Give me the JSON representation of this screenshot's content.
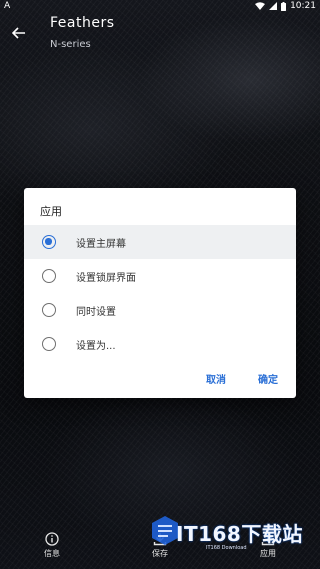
{
  "status_bar": {
    "left_icon": "android-a-icon",
    "left_text": "A",
    "time": "10:21",
    "icons": [
      "wifi-icon",
      "signal-icon",
      "battery-icon"
    ]
  },
  "app_bar": {
    "back_icon": "back-arrow-icon",
    "title": "Feathers",
    "subtitle": "N-series"
  },
  "dialog": {
    "title": "应用",
    "options": [
      {
        "label": "设置主屏幕",
        "selected": true
      },
      {
        "label": "设置锁屏界面",
        "selected": false
      },
      {
        "label": "同时设置",
        "selected": false
      },
      {
        "label": "设置为...",
        "selected": false
      }
    ],
    "cancel_label": "取消",
    "ok_label": "确定",
    "accent_color": "#2a6fd6"
  },
  "bottom_bar": {
    "items": [
      {
        "icon": "info-icon",
        "label": "信息"
      },
      {
        "icon": "download-icon",
        "label": "保存"
      },
      {
        "icon": "upload-icon",
        "label": "应用"
      }
    ]
  },
  "watermark": {
    "text": "IT168下载站",
    "sub": "IT168 Download"
  }
}
